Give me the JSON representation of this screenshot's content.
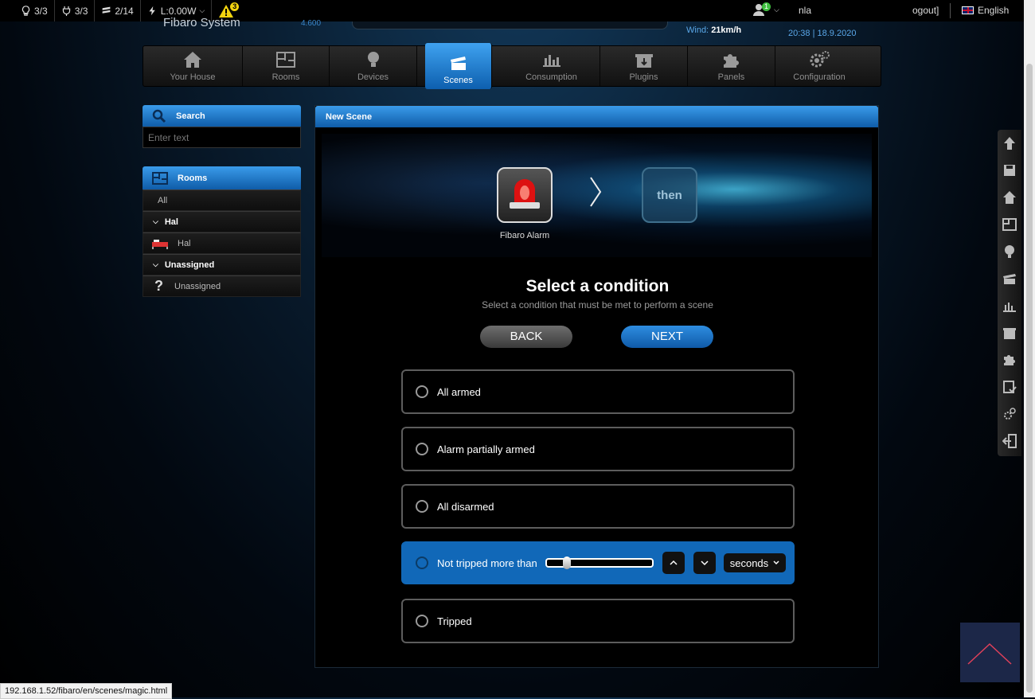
{
  "topbar": {
    "lights": "3/3",
    "plugs": "3/3",
    "blinds": "2/14",
    "power": "L:0.00W",
    "alerts": "3",
    "user_badge": "1",
    "username": "nla",
    "logout": "ogout]",
    "language": "English"
  },
  "header": {
    "brand": "Fibaro System",
    "version": "4.600",
    "wind_label": "Wind:",
    "wind_value": "21km/h",
    "datetime": "20:38 | 18.9.2020"
  },
  "nav": [
    {
      "label": "Your House"
    },
    {
      "label": "Rooms"
    },
    {
      "label": "Devices"
    },
    {
      "label": "Scenes"
    },
    {
      "label": "Consumption"
    },
    {
      "label": "Plugins"
    },
    {
      "label": "Panels"
    },
    {
      "label": "Configuration"
    }
  ],
  "search": {
    "title": "Search",
    "placeholder": "Enter text"
  },
  "rooms": {
    "title": "Rooms",
    "items": [
      {
        "label": "All"
      },
      {
        "label": "Hal"
      },
      {
        "label": "Hal"
      },
      {
        "label": "Unassigned"
      },
      {
        "label": "Unassigned"
      }
    ]
  },
  "scene": {
    "header": "New Scene",
    "step1_label": "Fibaro Alarm",
    "step2_label": "then",
    "title": "Select a condition",
    "subtitle": "Select a condition that must be met to perform a scene",
    "back": "BACK",
    "next": "NEXT",
    "options": [
      {
        "label": "All armed"
      },
      {
        "label": "Alarm partially armed"
      },
      {
        "label": "All disarmed"
      },
      {
        "label": "Not tripped more than"
      },
      {
        "label": "Tripped"
      }
    ],
    "unit": "seconds"
  },
  "status_url": "192.168.1.52/fibaro/en/scenes/magic.html"
}
